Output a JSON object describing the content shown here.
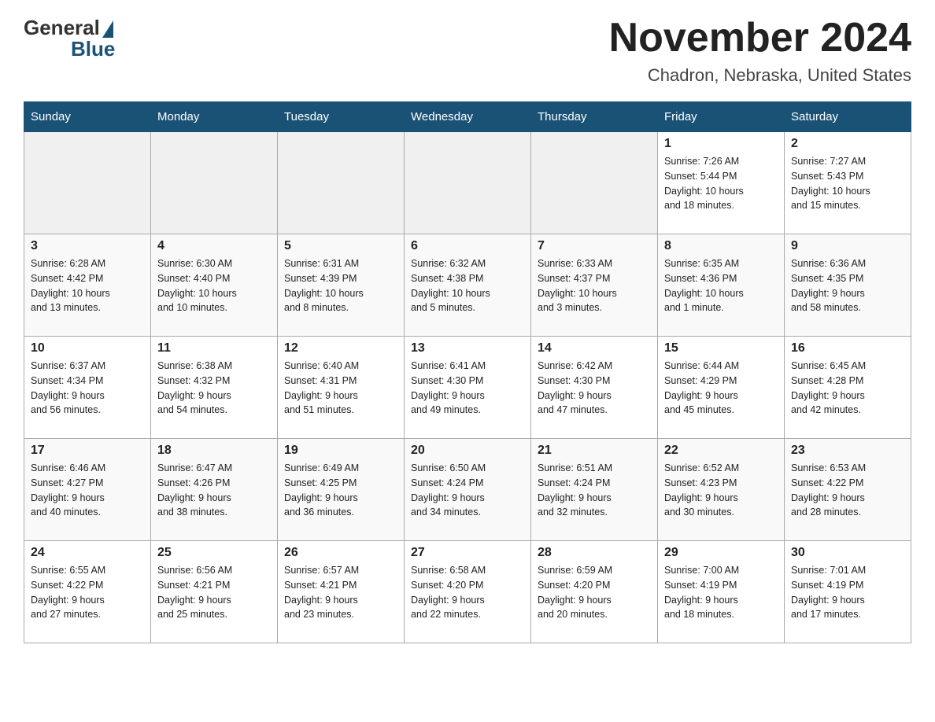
{
  "header": {
    "logo": {
      "general": "General",
      "blue": "Blue"
    },
    "title": "November 2024",
    "location": "Chadron, Nebraska, United States"
  },
  "weekdays": [
    "Sunday",
    "Monday",
    "Tuesday",
    "Wednesday",
    "Thursday",
    "Friday",
    "Saturday"
  ],
  "weeks": [
    [
      {
        "day": "",
        "info": ""
      },
      {
        "day": "",
        "info": ""
      },
      {
        "day": "",
        "info": ""
      },
      {
        "day": "",
        "info": ""
      },
      {
        "day": "",
        "info": ""
      },
      {
        "day": "1",
        "info": "Sunrise: 7:26 AM\nSunset: 5:44 PM\nDaylight: 10 hours\nand 18 minutes."
      },
      {
        "day": "2",
        "info": "Sunrise: 7:27 AM\nSunset: 5:43 PM\nDaylight: 10 hours\nand 15 minutes."
      }
    ],
    [
      {
        "day": "3",
        "info": "Sunrise: 6:28 AM\nSunset: 4:42 PM\nDaylight: 10 hours\nand 13 minutes."
      },
      {
        "day": "4",
        "info": "Sunrise: 6:30 AM\nSunset: 4:40 PM\nDaylight: 10 hours\nand 10 minutes."
      },
      {
        "day": "5",
        "info": "Sunrise: 6:31 AM\nSunset: 4:39 PM\nDaylight: 10 hours\nand 8 minutes."
      },
      {
        "day": "6",
        "info": "Sunrise: 6:32 AM\nSunset: 4:38 PM\nDaylight: 10 hours\nand 5 minutes."
      },
      {
        "day": "7",
        "info": "Sunrise: 6:33 AM\nSunset: 4:37 PM\nDaylight: 10 hours\nand 3 minutes."
      },
      {
        "day": "8",
        "info": "Sunrise: 6:35 AM\nSunset: 4:36 PM\nDaylight: 10 hours\nand 1 minute."
      },
      {
        "day": "9",
        "info": "Sunrise: 6:36 AM\nSunset: 4:35 PM\nDaylight: 9 hours\nand 58 minutes."
      }
    ],
    [
      {
        "day": "10",
        "info": "Sunrise: 6:37 AM\nSunset: 4:34 PM\nDaylight: 9 hours\nand 56 minutes."
      },
      {
        "day": "11",
        "info": "Sunrise: 6:38 AM\nSunset: 4:32 PM\nDaylight: 9 hours\nand 54 minutes."
      },
      {
        "day": "12",
        "info": "Sunrise: 6:40 AM\nSunset: 4:31 PM\nDaylight: 9 hours\nand 51 minutes."
      },
      {
        "day": "13",
        "info": "Sunrise: 6:41 AM\nSunset: 4:30 PM\nDaylight: 9 hours\nand 49 minutes."
      },
      {
        "day": "14",
        "info": "Sunrise: 6:42 AM\nSunset: 4:30 PM\nDaylight: 9 hours\nand 47 minutes."
      },
      {
        "day": "15",
        "info": "Sunrise: 6:44 AM\nSunset: 4:29 PM\nDaylight: 9 hours\nand 45 minutes."
      },
      {
        "day": "16",
        "info": "Sunrise: 6:45 AM\nSunset: 4:28 PM\nDaylight: 9 hours\nand 42 minutes."
      }
    ],
    [
      {
        "day": "17",
        "info": "Sunrise: 6:46 AM\nSunset: 4:27 PM\nDaylight: 9 hours\nand 40 minutes."
      },
      {
        "day": "18",
        "info": "Sunrise: 6:47 AM\nSunset: 4:26 PM\nDaylight: 9 hours\nand 38 minutes."
      },
      {
        "day": "19",
        "info": "Sunrise: 6:49 AM\nSunset: 4:25 PM\nDaylight: 9 hours\nand 36 minutes."
      },
      {
        "day": "20",
        "info": "Sunrise: 6:50 AM\nSunset: 4:24 PM\nDaylight: 9 hours\nand 34 minutes."
      },
      {
        "day": "21",
        "info": "Sunrise: 6:51 AM\nSunset: 4:24 PM\nDaylight: 9 hours\nand 32 minutes."
      },
      {
        "day": "22",
        "info": "Sunrise: 6:52 AM\nSunset: 4:23 PM\nDaylight: 9 hours\nand 30 minutes."
      },
      {
        "day": "23",
        "info": "Sunrise: 6:53 AM\nSunset: 4:22 PM\nDaylight: 9 hours\nand 28 minutes."
      }
    ],
    [
      {
        "day": "24",
        "info": "Sunrise: 6:55 AM\nSunset: 4:22 PM\nDaylight: 9 hours\nand 27 minutes."
      },
      {
        "day": "25",
        "info": "Sunrise: 6:56 AM\nSunset: 4:21 PM\nDaylight: 9 hours\nand 25 minutes."
      },
      {
        "day": "26",
        "info": "Sunrise: 6:57 AM\nSunset: 4:21 PM\nDaylight: 9 hours\nand 23 minutes."
      },
      {
        "day": "27",
        "info": "Sunrise: 6:58 AM\nSunset: 4:20 PM\nDaylight: 9 hours\nand 22 minutes."
      },
      {
        "day": "28",
        "info": "Sunrise: 6:59 AM\nSunset: 4:20 PM\nDaylight: 9 hours\nand 20 minutes."
      },
      {
        "day": "29",
        "info": "Sunrise: 7:00 AM\nSunset: 4:19 PM\nDaylight: 9 hours\nand 18 minutes."
      },
      {
        "day": "30",
        "info": "Sunrise: 7:01 AM\nSunset: 4:19 PM\nDaylight: 9 hours\nand 17 minutes."
      }
    ]
  ]
}
